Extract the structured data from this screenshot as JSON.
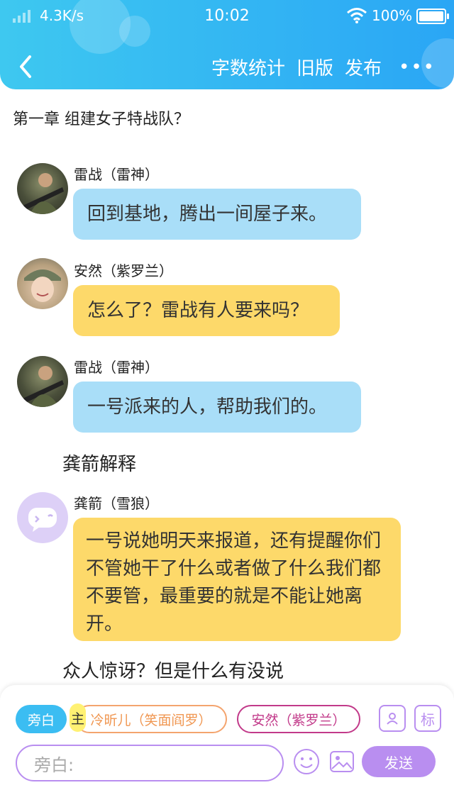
{
  "status_bar": {
    "speed": "4.3K/s",
    "time": "10:02",
    "battery": "100%"
  },
  "header": {
    "word_count": "字数统计",
    "old_version": "旧版",
    "publish": "发布",
    "more": "•••"
  },
  "chapter_title": "第一章 组建女子特战队？",
  "messages": [
    {
      "name": "雷战（雷神）",
      "text": "回到基地，腾出一间屋子来。"
    },
    {
      "name": "安然（紫罗兰）",
      "text": "怎么了？雷战有人要来吗？"
    },
    {
      "name": "雷战（雷神）",
      "text": "一号派来的人，帮助我们的。"
    },
    {
      "name": "龚箭（雪狼）",
      "text": "一号说她明天来报道，还有提醒你们不管她干了什么或者做了什么我们都不要管，最重要的就是不能让她离开。"
    }
  ],
  "narrations": [
    "龚箭解释",
    "众人惊讶？但是什么有没说"
  ],
  "composer": {
    "narration_chip": "旁白",
    "main_tag": "主",
    "role_chip_1": "冷昕儿（笑面阎罗）",
    "role_chip_2": "安然（紫罗兰）",
    "mark_icon": "标",
    "input_placeholder": "旁白:",
    "send_label": "发送"
  },
  "colors": {
    "header": "#2aa6f5",
    "blue_bubble": "#a9def8",
    "yellow_bubble": "#fdd96a",
    "accent_purple": "#b98ef0"
  },
  "icons": [
    "back-arrow-icon",
    "more-dots-icon",
    "wifi-icon",
    "battery-icon",
    "character-card-icon",
    "mark-icon",
    "emoji-icon",
    "image-icon"
  ]
}
